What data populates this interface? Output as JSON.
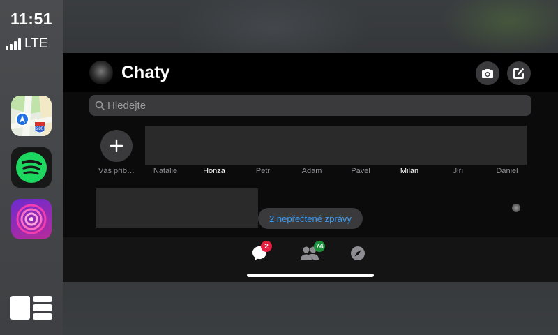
{
  "status": {
    "time": "11:51",
    "network": "LTE"
  },
  "dock": {
    "apps": [
      {
        "name": "Maps",
        "icon": "maps-icon"
      },
      {
        "name": "Spotify",
        "icon": "spotify-icon"
      },
      {
        "name": "Podcast",
        "icon": "podcast-icon"
      }
    ],
    "maps_shield_text": "280"
  },
  "header": {
    "title": "Chaty"
  },
  "search": {
    "placeholder": "Hledejte"
  },
  "stories": {
    "add_label": "Váš příb…",
    "people": [
      {
        "name": "Natálie",
        "bold": false
      },
      {
        "name": "Honza",
        "bold": true
      },
      {
        "name": "Petr",
        "bold": false
      },
      {
        "name": "Adam",
        "bold": false
      },
      {
        "name": "Pavel",
        "bold": false
      },
      {
        "name": "Milan",
        "bold": true
      },
      {
        "name": "Jiří",
        "bold": false
      },
      {
        "name": "Daniel",
        "bold": false
      }
    ]
  },
  "unread": {
    "label": "2 nepřečtené zprávy"
  },
  "tabs": {
    "chats_badge": "2",
    "people_badge": "74"
  },
  "colors": {
    "accent": "#3d9df5",
    "badge_red": "#e41e3f",
    "badge_green": "#1d8f3a",
    "spotify": "#1ed760"
  }
}
